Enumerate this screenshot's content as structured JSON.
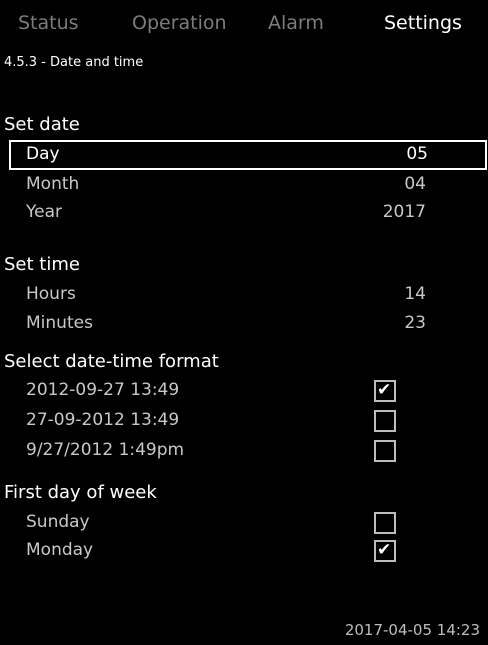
{
  "tabs": {
    "status": "Status",
    "operation": "Operation",
    "alarm": "Alarm",
    "settings": "Settings"
  },
  "breadcrumb": "4.5.3 - Date and time",
  "set_date": {
    "heading": "Set date",
    "day": {
      "label": "Day",
      "value": "05"
    },
    "month": {
      "label": "Month",
      "value": "04"
    },
    "year": {
      "label": "Year",
      "value": "2017"
    }
  },
  "set_time": {
    "heading": "Set time",
    "hours": {
      "label": "Hours",
      "value": "14"
    },
    "minutes": {
      "label": "Minutes",
      "value": "23"
    }
  },
  "format": {
    "heading": "Select date-time format",
    "options": [
      {
        "label": "2012-09-27  13:49",
        "checked": true
      },
      {
        "label": "27-09-2012  13:49",
        "checked": false
      },
      {
        "label": "9/27/2012  1:49pm",
        "checked": false
      }
    ]
  },
  "first_day": {
    "heading": "First day of week",
    "options": [
      {
        "label": "Sunday",
        "checked": false
      },
      {
        "label": "Monday",
        "checked": true
      }
    ]
  },
  "check_mark": "✔",
  "footer_datetime": "2017-04-05  14:23",
  "colors": {
    "background": "#000000",
    "active_tab": "#ffffff",
    "inactive_tab": "#7c7c7c"
  }
}
